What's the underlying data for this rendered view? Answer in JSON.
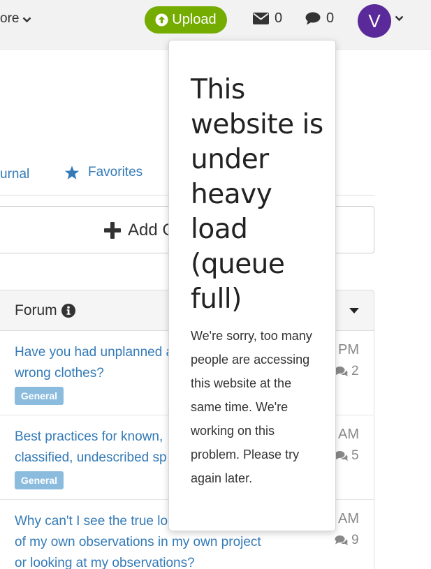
{
  "header": {
    "more_label": "ore",
    "upload_label": "Upload",
    "messages_count": "0",
    "comments_count": "0",
    "avatar_letter": "V"
  },
  "tabs": {
    "journal_label": "urnal",
    "favorites_label": "Favorites"
  },
  "add_button": {
    "label": "Add C"
  },
  "forum": {
    "title": "Forum",
    "rows": [
      {
        "title": "Have you had unplanned a... wrong clothes?",
        "title_lines": [
          "Have you had unplanned a",
          "wrong clothes?"
        ],
        "badge": "General",
        "time": "PM",
        "count": "2"
      },
      {
        "title": "Best practices for known, classified, undescribed sp",
        "title_lines": [
          "Best practices for known,",
          "classified, undescribed sp"
        ],
        "badge": "General",
        "time": "AM",
        "count": "5"
      },
      {
        "title": "Why can't I see the true lo of my own observations in my own project or looking at my observations?",
        "title_lines": [
          "Why can't I see the true lo",
          "of my own observations in my own project",
          "or looking at my observations?"
        ],
        "badge": "",
        "time": "AM",
        "count": "9"
      }
    ]
  },
  "popover": {
    "title": "This website is under heavy load (queue full)",
    "body": "We're sorry, too many people are accessing this website at the same time. We're working on this problem. Please try again later."
  },
  "colors": {
    "upload_green": "#74ac00",
    "avatar_purple": "#5b2a9a",
    "link_blue": "#337ab7",
    "badge_blue": "#8bbcde"
  }
}
